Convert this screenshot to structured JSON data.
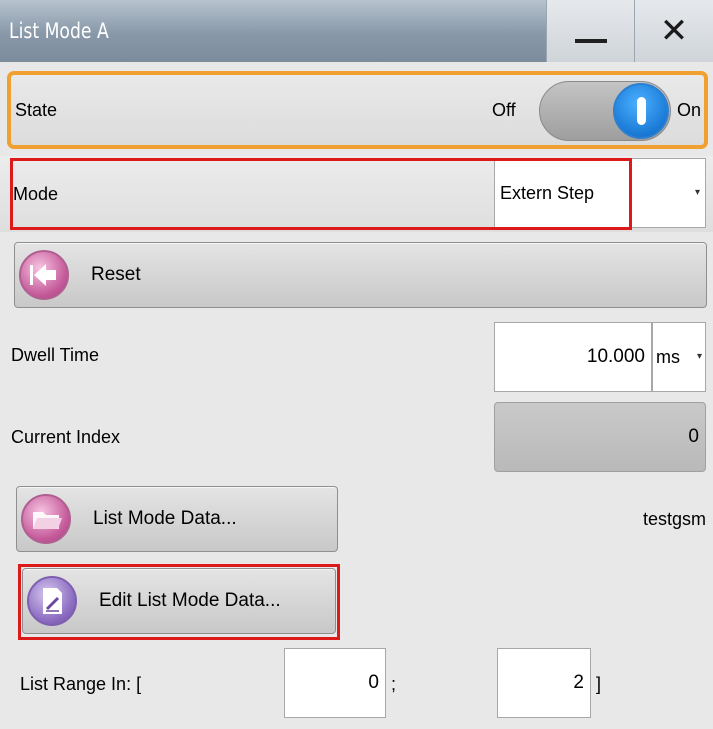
{
  "window": {
    "title": "List Mode A",
    "minimize_label": "Minimize",
    "close_label": "Close"
  },
  "state": {
    "label": "State",
    "off_label": "Off",
    "on_label": "On",
    "value": "On"
  },
  "mode": {
    "label": "Mode",
    "selected": "Extern Step"
  },
  "reset": {
    "label": "Reset"
  },
  "dwell_time": {
    "label": "Dwell Time",
    "value": "10.000",
    "unit": "ms"
  },
  "current_index": {
    "label": "Current Index",
    "value": "0"
  },
  "list_mode_data": {
    "button_label": "List Mode Data...",
    "file_name": "testgsm"
  },
  "edit_list_mode_data": {
    "button_label": "Edit List Mode Data..."
  },
  "list_range": {
    "label": "List Range In: [",
    "start_value": "0",
    "separator": ";",
    "end_value": "2",
    "close_bracket": "]"
  },
  "colors": {
    "accent_orange": "#f0a030",
    "highlight_red": "#dd1a1a",
    "toggle_blue": "#1a7ad6",
    "icon_pink": "#c55b9b",
    "icon_violet": "#8b6cc0"
  }
}
